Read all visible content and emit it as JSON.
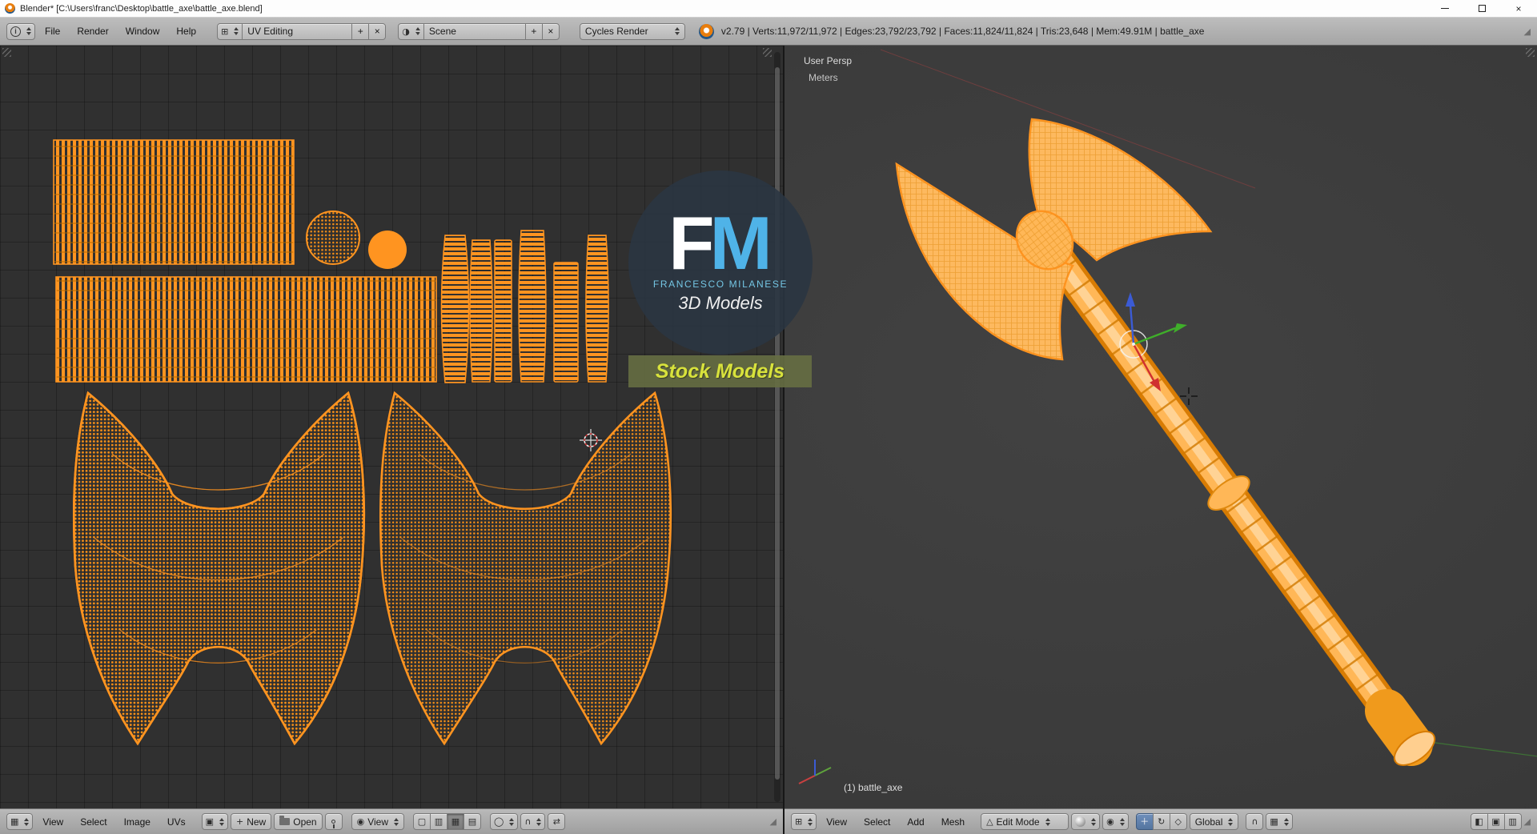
{
  "titlebar": {
    "title": "Blender* [C:\\Users\\franc\\Desktop\\battle_axe\\battle_axe.blend]",
    "close_glyph": "×"
  },
  "info_header": {
    "menus": [
      "File",
      "Render",
      "Window",
      "Help"
    ],
    "layout": "UV Editing",
    "scene": "Scene",
    "engine": "Cycles Render",
    "add_label": "+",
    "close_label": "×",
    "stats": "v2.79 | Verts:11,972/11,972 | Edges:23,792/23,792 | Faces:11,824/11,824 | Tris:23,648 | Mem:49.91M | battle_axe"
  },
  "uv_editor": {
    "menus": [
      "View",
      "Select",
      "Image",
      "UVs"
    ],
    "plus_glyph": "+",
    "new_button": "New",
    "open_button": "Open",
    "display_dropdown": "View"
  },
  "viewport3d": {
    "view_label": "User Persp",
    "units_label": "Meters",
    "object_info": "(1) battle_axe",
    "menus": [
      "View",
      "Select",
      "Add",
      "Mesh"
    ],
    "mode": "Edit Mode",
    "orientation": "Global"
  },
  "watermark": {
    "monogram_f": "F",
    "monogram_m": "M",
    "author": "FRANCESCO MILANESE",
    "tagline": "3D Models",
    "badge": "Stock Models"
  },
  "colors": {
    "selection_orange": "#ff9420",
    "pressed_blue": "#5a7fb5",
    "axis_x_red": "#c94040",
    "axis_y_green": "#5fa33c",
    "axis_z_blue": "#3b5bd4"
  }
}
